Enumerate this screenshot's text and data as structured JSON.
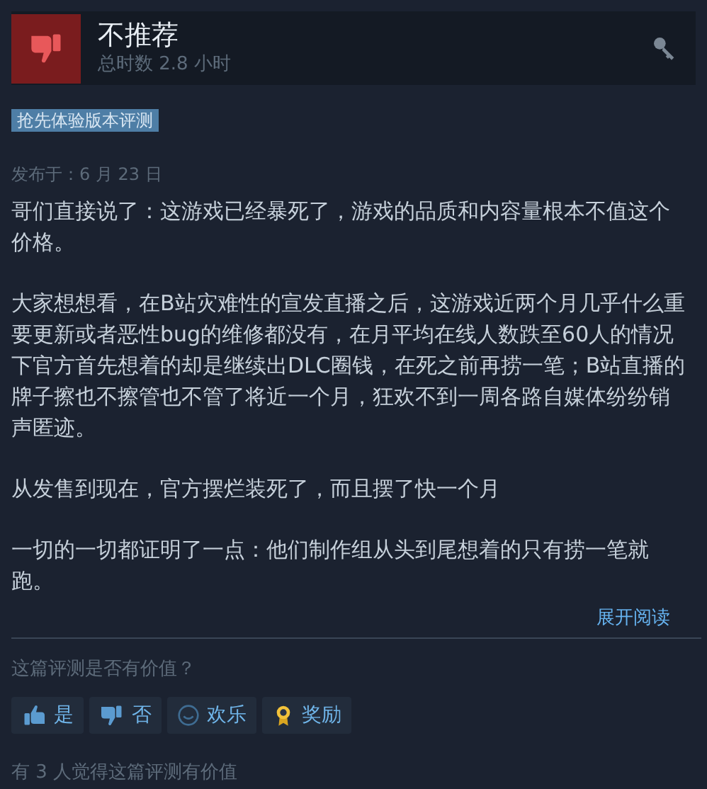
{
  "review": {
    "verdict": "不推荐",
    "recommended": false,
    "hours": "总时数 2.8 小时",
    "tag": "抢先体验版本评测",
    "date": "发布于：6 月 23 日",
    "paragraphs": [
      "哥们直接说了：这游戏已经暴死了，游戏的品质和内容量根本不值这个价格。",
      "大家想想看，在B站灾难性的宣发直播之后，这游戏近两个月几乎什么重要更新或者恶性bug的维修都没有，在月平均在线人数跌至60人的情况下官方首先想着的却是继续出DLC圈钱，在死之前再捞一笔；B站直播的牌子擦也不擦管也不管了将近一个月，狂欢不到一周各路自媒体纷纷销声匿迹。",
      "从发售到现在，官方摆烂装死了，而且摆了快一个月",
      "一切的一切都证明了一点：他们制作组从头到尾想着的只有捞一笔就跑。"
    ],
    "expand": "展开阅读"
  },
  "feedback": {
    "question": "这篇评测是否有价值？",
    "buttons": [
      {
        "kind": "yes",
        "label": "是"
      },
      {
        "kind": "no",
        "label": "否"
      },
      {
        "kind": "funny",
        "label": "欢乐"
      },
      {
        "kind": "award",
        "label": "奖励"
      }
    ],
    "helpful": "有 3 人觉得这篇评测有价值"
  }
}
